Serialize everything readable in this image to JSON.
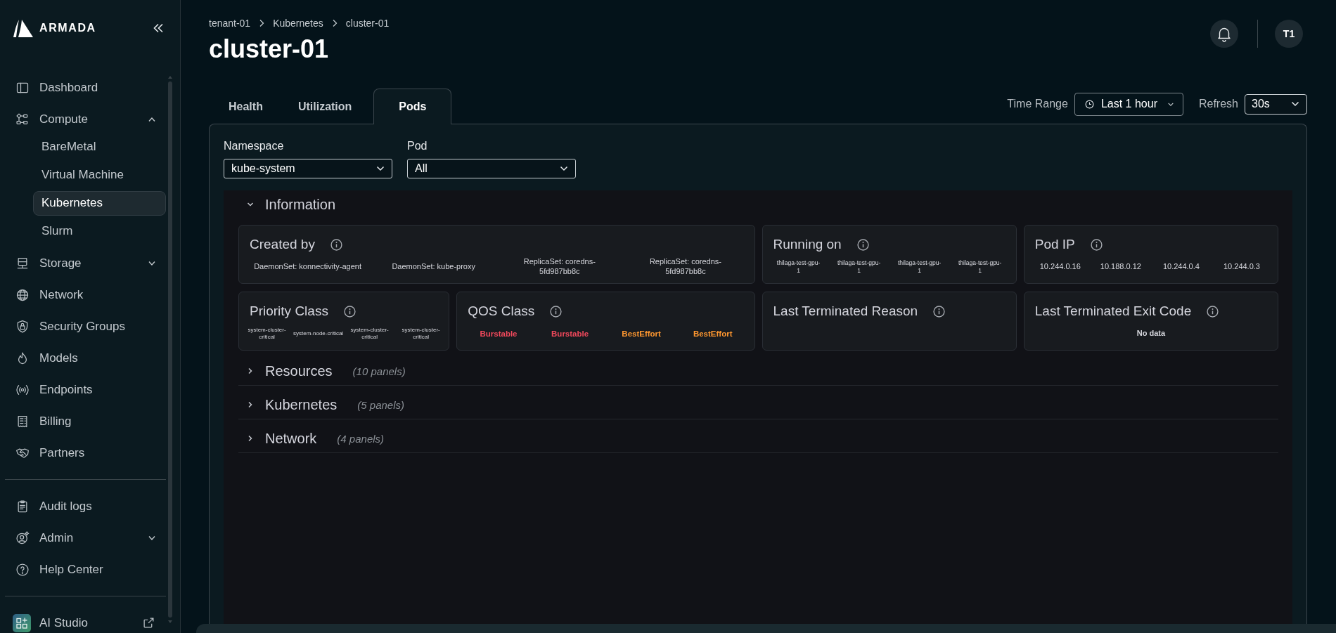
{
  "sidebar": {
    "brand": "ARMADA",
    "sections": [
      {
        "items": [
          {
            "label": "Dashboard",
            "selected": false
          },
          {
            "label": "Compute",
            "selected": false,
            "expanded": true,
            "children": [
              {
                "label": "BareMetal",
                "selected": false
              },
              {
                "label": "Virtual Machine",
                "selected": false
              },
              {
                "label": "Kubernetes",
                "selected": true
              },
              {
                "label": "Slurm",
                "selected": false
              }
            ]
          },
          {
            "label": "Storage",
            "selected": false,
            "expanded": false
          },
          {
            "label": "Network",
            "selected": false
          },
          {
            "label": "Security Groups",
            "selected": false
          },
          {
            "label": "Models",
            "selected": false
          },
          {
            "label": "Endpoints",
            "selected": false
          },
          {
            "label": "Billing",
            "selected": false
          },
          {
            "label": "Partners",
            "selected": false
          }
        ]
      },
      {
        "items": [
          {
            "label": "Audit logs",
            "selected": false
          },
          {
            "label": "Admin",
            "selected": false,
            "expanded": false
          },
          {
            "label": "Help Center",
            "selected": false
          }
        ]
      }
    ],
    "app_link": {
      "label": "AI Studio"
    }
  },
  "header": {
    "breadcrumbs": [
      "tenant-01",
      "Kubernetes",
      "cluster-01"
    ],
    "title": "cluster-01",
    "avatar": "T1"
  },
  "tabs": [
    {
      "label": "Health",
      "selected": false
    },
    {
      "label": "Utilization",
      "selected": false
    },
    {
      "label": "Pods",
      "selected": true
    }
  ],
  "time_range": {
    "label": "Time Range",
    "value": "Last 1 hour"
  },
  "refresh": {
    "label": "Refresh",
    "value": "30s"
  },
  "filters": [
    {
      "label": "Namespace",
      "value": "kube-system"
    },
    {
      "label": "Pod",
      "value": "All"
    }
  ],
  "rows": [
    {
      "title": "Information",
      "expanded": true,
      "panels": [
        {
          "title": "Created by",
          "values": [
            {
              "text": "DaemonSet: konnectivity-agent"
            },
            {
              "text": "DaemonSet: kube-proxy"
            },
            {
              "text": "ReplicaSet: coredns-5fd987bb8c"
            },
            {
              "text": "ReplicaSet: coredns-5fd987bb8c"
            }
          ]
        },
        {
          "title": "Running on",
          "values": [
            {
              "text": "thilaga-test-gpu-1"
            },
            {
              "text": "thilaga-test-gpu-1"
            },
            {
              "text": "thilaga-test-gpu-1"
            },
            {
              "text": "thilaga-test-gpu-1"
            }
          ]
        },
        {
          "title": "Pod IP",
          "values": [
            {
              "text": "10.244.0.16"
            },
            {
              "text": "10.188.0.12"
            },
            {
              "text": "10.244.0.4"
            },
            {
              "text": "10.244.0.3"
            }
          ]
        },
        {
          "title": "Priority Class",
          "values": [
            {
              "text": "system-cluster-critical"
            },
            {
              "text": "system-node-critical"
            },
            {
              "text": "system-cluster-critical"
            },
            {
              "text": "system-cluster-critical"
            }
          ]
        },
        {
          "title": "QOS Class",
          "values": [
            {
              "text": "Burstable",
              "color": "#f2495c"
            },
            {
              "text": "Burstable",
              "color": "#f2495c"
            },
            {
              "text": "BestEffort",
              "color": "#ff9830"
            },
            {
              "text": "BestEffort",
              "color": "#ff9830"
            }
          ]
        },
        {
          "title": "Last Terminated Reason"
        },
        {
          "title": "Last Terminated Exit Code",
          "values": [
            {
              "text": "No data"
            }
          ]
        }
      ]
    },
    {
      "title": "Resources",
      "expanded": false,
      "count": "(10 panels)"
    },
    {
      "title": "Kubernetes",
      "expanded": false,
      "count": "(5 panels)"
    },
    {
      "title": "Network",
      "expanded": false,
      "count": "(4 panels)"
    }
  ]
}
